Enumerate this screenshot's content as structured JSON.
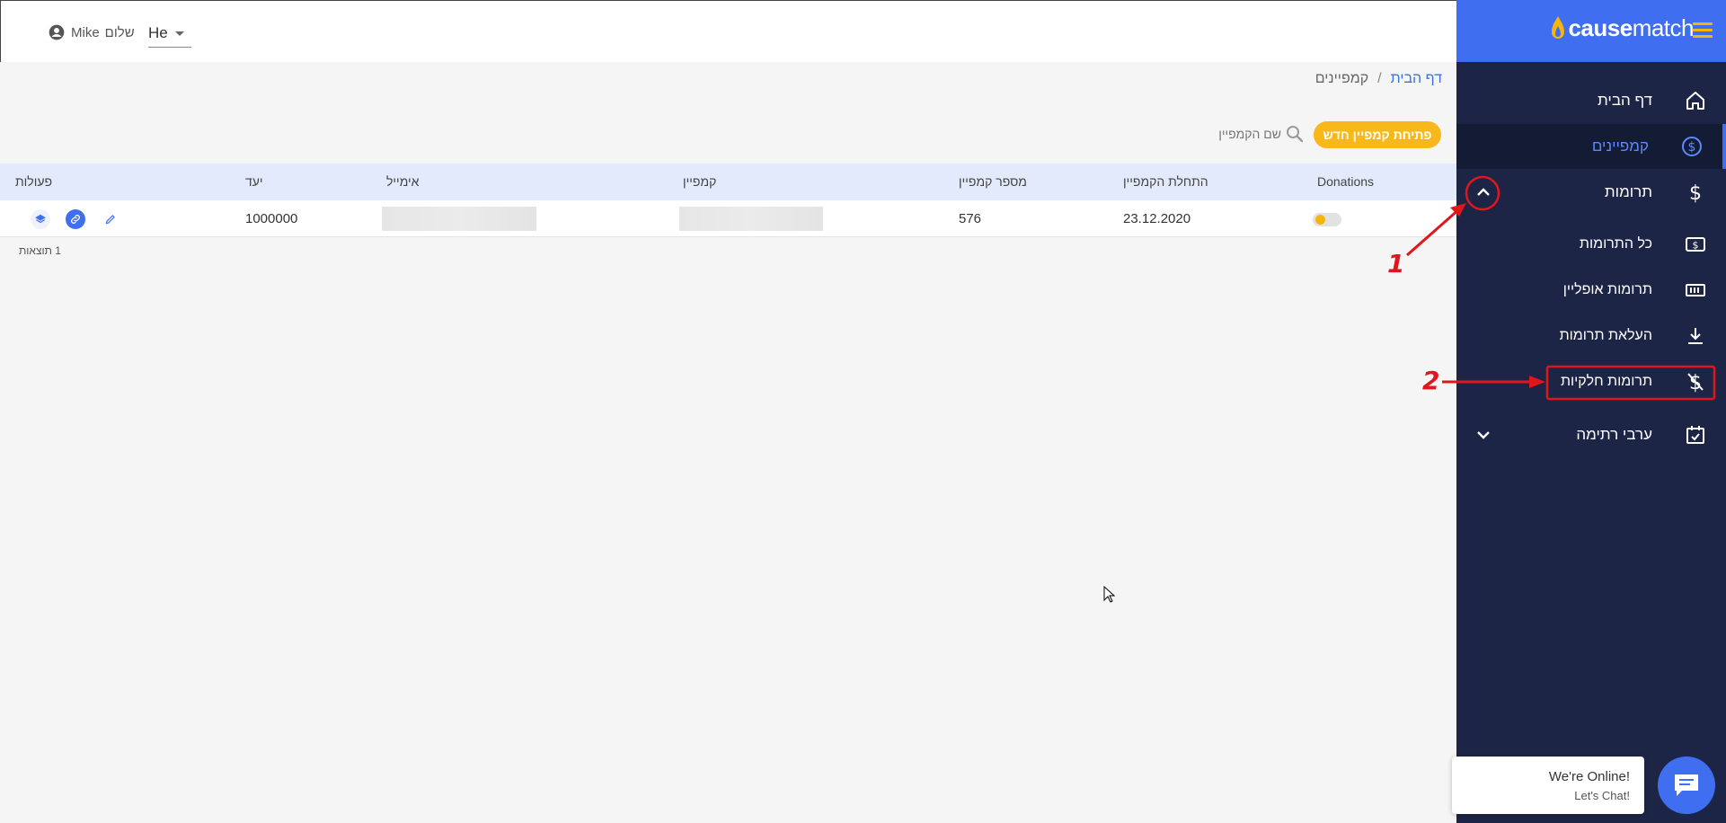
{
  "sidebar": {
    "logo_text_bold": "cause",
    "logo_text_regular": "match",
    "items": [
      {
        "label": "דף הבית",
        "icon": "home-icon"
      },
      {
        "label": "קמפיינים",
        "icon": "dollar-circle-icon",
        "active": true
      },
      {
        "label": "תרומות",
        "icon": "dollar-icon",
        "expanded": true
      },
      {
        "label": "כל התרומות",
        "icon": "money-box-icon"
      },
      {
        "label": "תרומות אופליין",
        "icon": "cash-stack-icon"
      },
      {
        "label": "העלאת תרומות",
        "icon": "download-icon"
      },
      {
        "label": "תרומות חלקיות",
        "icon": "dollar-off-icon"
      },
      {
        "label": "ערבי רתימה",
        "icon": "calendar-check-icon"
      }
    ]
  },
  "topbar": {
    "language": "He",
    "user_name": "Mike",
    "greeting": "שלום"
  },
  "breadcrumb": {
    "home": "דף הבית",
    "separator": "/",
    "current": "קמפיינים"
  },
  "toolbar": {
    "new_campaign_label": "פתיחת קמפיין חדש",
    "search_placeholder": "שם הקמפיין"
  },
  "table": {
    "headers": {
      "donations": "Donations",
      "start_date": "התחלת הקמפיין",
      "campaign_number": "מספר קמפיין",
      "campaign": "קמפיין",
      "email": "אימייל",
      "goal": "יעד",
      "actions": "פעולות"
    },
    "rows": [
      {
        "start_date": "23.12.2020",
        "campaign_number": "576",
        "goal": "1000000",
        "donations_enabled": false
      }
    ],
    "results_label": "1 תוצאות"
  },
  "annotations": {
    "label_1": "1",
    "label_2": "2",
    "color": "#e0161c"
  },
  "chat": {
    "title": "We're Online!",
    "subtitle": "Let's Chat!"
  },
  "colors": {
    "brand": "#3f6ef0",
    "accent": "#f9b81a",
    "sidebar_bg": "#1d2546"
  }
}
